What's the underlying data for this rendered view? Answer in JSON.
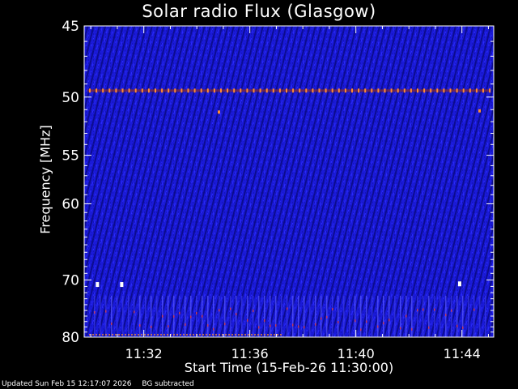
{
  "chart_data": {
    "type": "heatmap",
    "title": "Solar radio Flux (Glasgow)",
    "xlabel": "Start Time (15-Feb-26 11:30:00)",
    "ylabel": "Frequency [MHz]",
    "x_ticks": [
      "11:32",
      "11:36",
      "11:40",
      "11:44"
    ],
    "y_ticks": [
      45,
      50,
      55,
      60,
      70,
      80
    ],
    "y_scale": "reciprocal",
    "ylim": [
      45,
      80
    ],
    "colors": {
      "background": "#1a1ad8",
      "stripe": "#0c0c8e",
      "emission": "#ff8c32",
      "hot": "#ffffff"
    },
    "features": [
      {
        "kind": "horizontal_band",
        "frequency": 49.5,
        "color": "emission"
      },
      {
        "kind": "spot",
        "time": "11:34:50",
        "frequency": 51.2,
        "color": "emission"
      },
      {
        "kind": "spot",
        "time": "11:44:40",
        "frequency": 51.1,
        "color": "emission"
      },
      {
        "kind": "spot",
        "time": "11:30:15",
        "frequency": 70.7,
        "color": "hot"
      },
      {
        "kind": "spot",
        "time": "11:31:10",
        "frequency": 70.7,
        "color": "hot"
      },
      {
        "kind": "spot",
        "time": "11:43:55",
        "frequency": 70.6,
        "color": "hot"
      },
      {
        "kind": "vertical_streaks",
        "from_frequency": 72.5,
        "to_frequency": 80,
        "color": "emission"
      }
    ]
  },
  "footer": {
    "updated": "Updated Sun Feb 15 12:17:07 2026",
    "mode": "BG subtracted"
  }
}
